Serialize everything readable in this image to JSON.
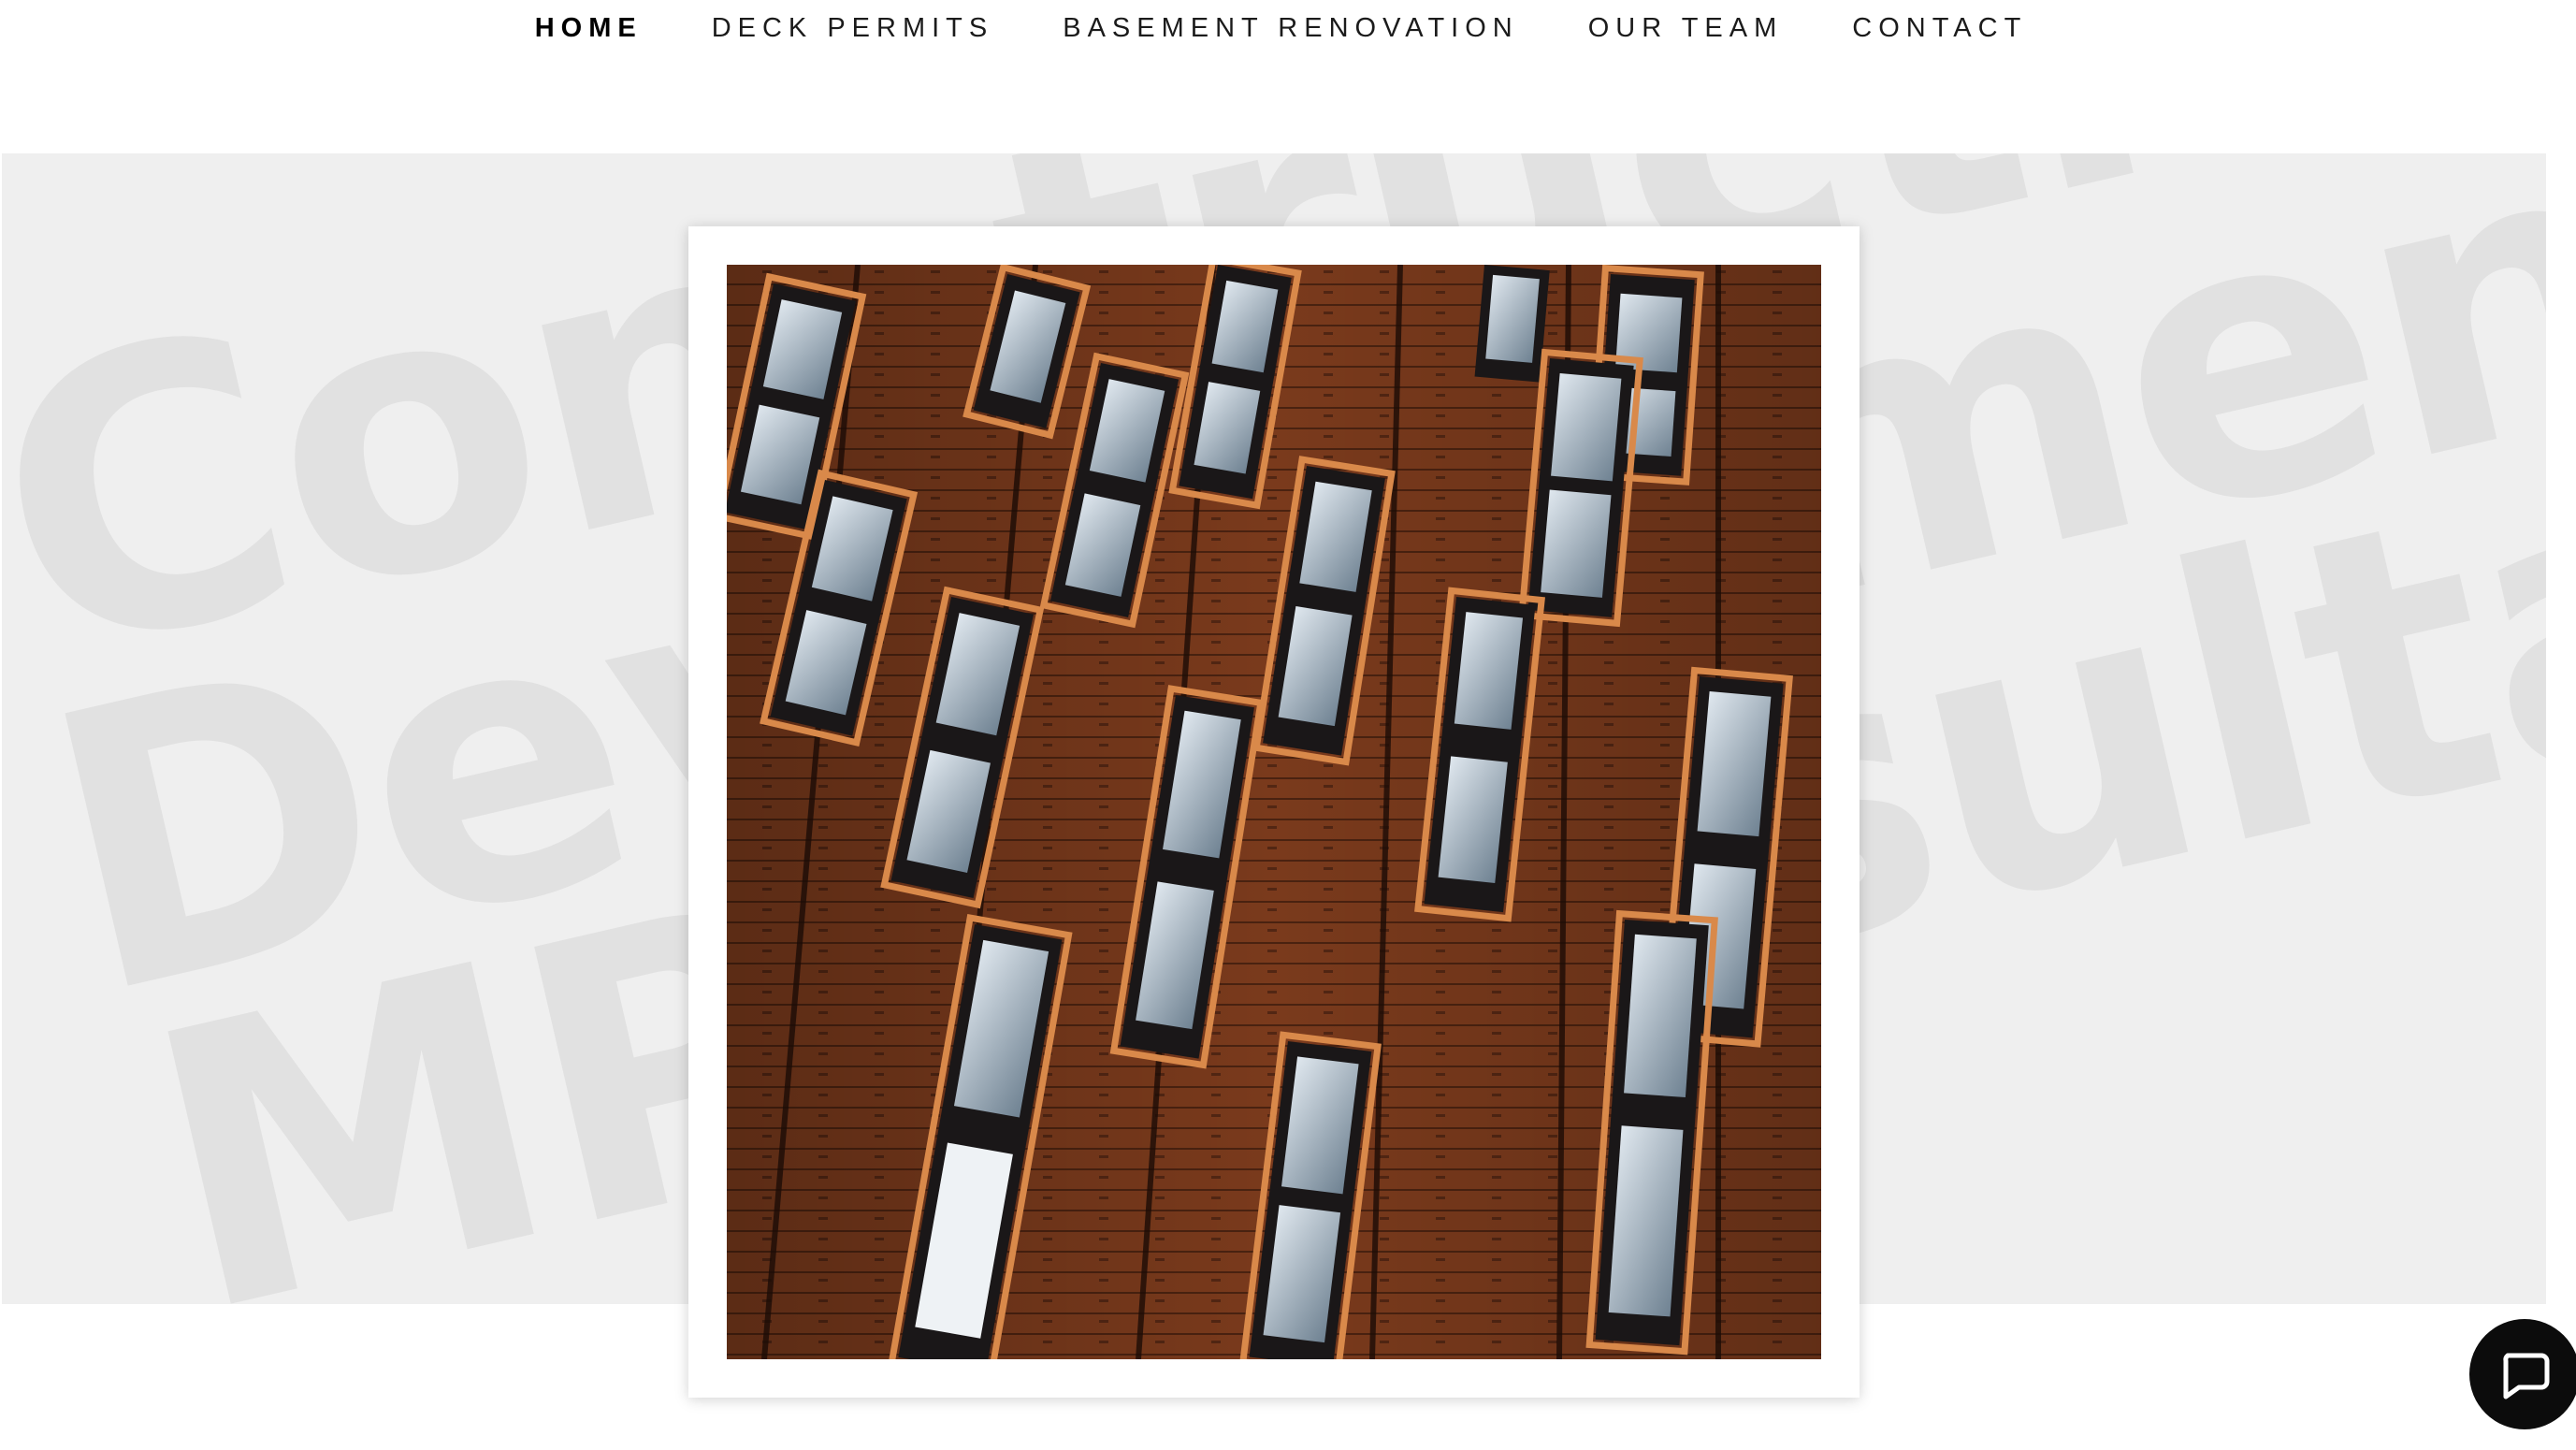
{
  "nav": {
    "items": [
      {
        "label": "HOME",
        "active": true
      },
      {
        "label": "DECK PERMITS",
        "active": false
      },
      {
        "label": "BASEMENT RENOVATION",
        "active": false
      },
      {
        "label": "OUR TEAM",
        "active": false
      },
      {
        "label": "CONTACT",
        "active": false
      }
    ]
  },
  "hero": {
    "watermark_lines": [
      "Construction Management",
      "Development Real Estate",
      "MP Consultation"
    ],
    "background_color": "#efefef",
    "watermark_color": "#e1e1e1"
  },
  "image": {
    "subject": "building facade with angled copper-framed windows",
    "colors": {
      "cladding": "#7a3a1c",
      "trim": "#d9894a",
      "glass": "#a9b8c4"
    }
  },
  "chat": {
    "icon": "chat-bubble-icon"
  }
}
